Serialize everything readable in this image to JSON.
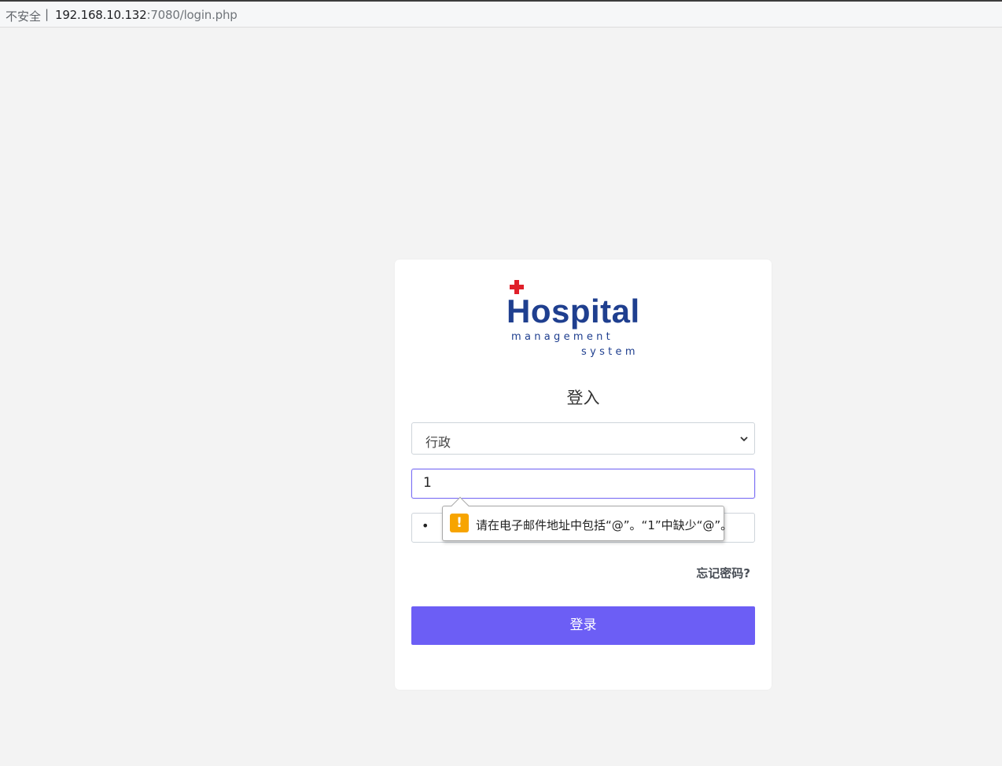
{
  "browser": {
    "security_label": "不安全",
    "separator": "|",
    "url_host": "192.168.10.132",
    "url_path": ":7080/login.php"
  },
  "logo": {
    "word": "Hospital",
    "line2": "management",
    "line3": "system",
    "colors": {
      "primary": "#1f3f8f",
      "cross": "#e0202a"
    }
  },
  "form": {
    "title": "登入",
    "role_select": {
      "value": "行政"
    },
    "email": {
      "value": "1"
    },
    "password": {
      "value": "•"
    },
    "forgot_label": "忘记密码?",
    "submit_label": "登录"
  },
  "validation_tooltip": {
    "icon": "warning-icon",
    "icon_glyph": "!",
    "message": "请在电子邮件地址中包括“@”。“1”中缺少“@”。"
  },
  "colors": {
    "accent": "#6c5ef5",
    "background": "#f3f3f3",
    "warning": "#f7a400"
  }
}
